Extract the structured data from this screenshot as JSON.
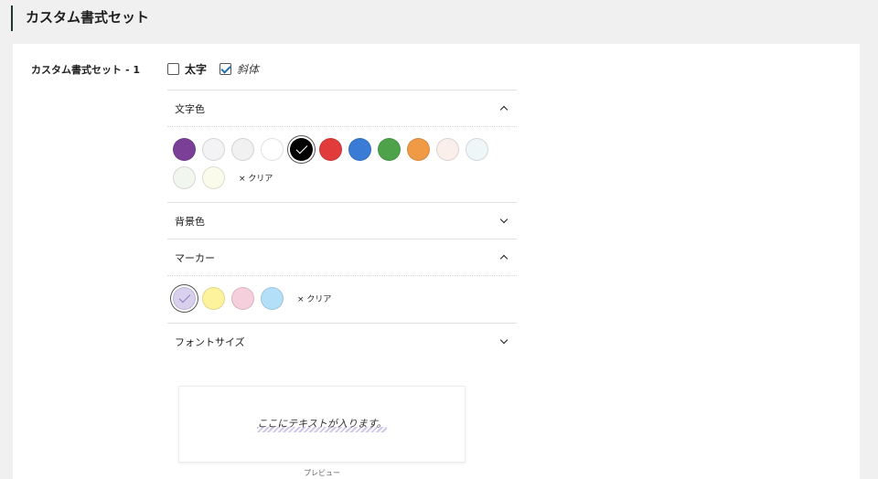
{
  "page": {
    "title": "カスタム書式セット"
  },
  "set": {
    "label": "カスタム書式セット",
    "number": "- 1"
  },
  "toggles": [
    {
      "label": "太字",
      "checked": false
    },
    {
      "label": "斜体",
      "checked": true
    }
  ],
  "sections": {
    "text_color": {
      "label": "文字色",
      "expanded": true,
      "swatches": [
        "#7b3f98",
        "#f3f2f5",
        "#f1f1f1",
        "#ffffff",
        "#000000",
        "#e23b3b",
        "#3a7bd5",
        "#4ea34a",
        "#f09a46",
        "#fbefeb",
        "#eef6f8",
        "#f1f7ee",
        "#fbfbec"
      ],
      "selected_index": 4,
      "clear_label": "× クリア"
    },
    "background_color": {
      "label": "背景色",
      "expanded": false
    },
    "marker": {
      "label": "マーカー",
      "expanded": true,
      "swatches": [
        "#d9d0ee",
        "#fdf39c",
        "#f5cfdb",
        "#b3e0f8"
      ],
      "selected_index": 0,
      "clear_label": "× クリア"
    },
    "font_size": {
      "label": "フォントサイズ",
      "expanded": false
    }
  },
  "preview": {
    "text": "ここにテキストが入ります。",
    "label": "プレビュー"
  }
}
